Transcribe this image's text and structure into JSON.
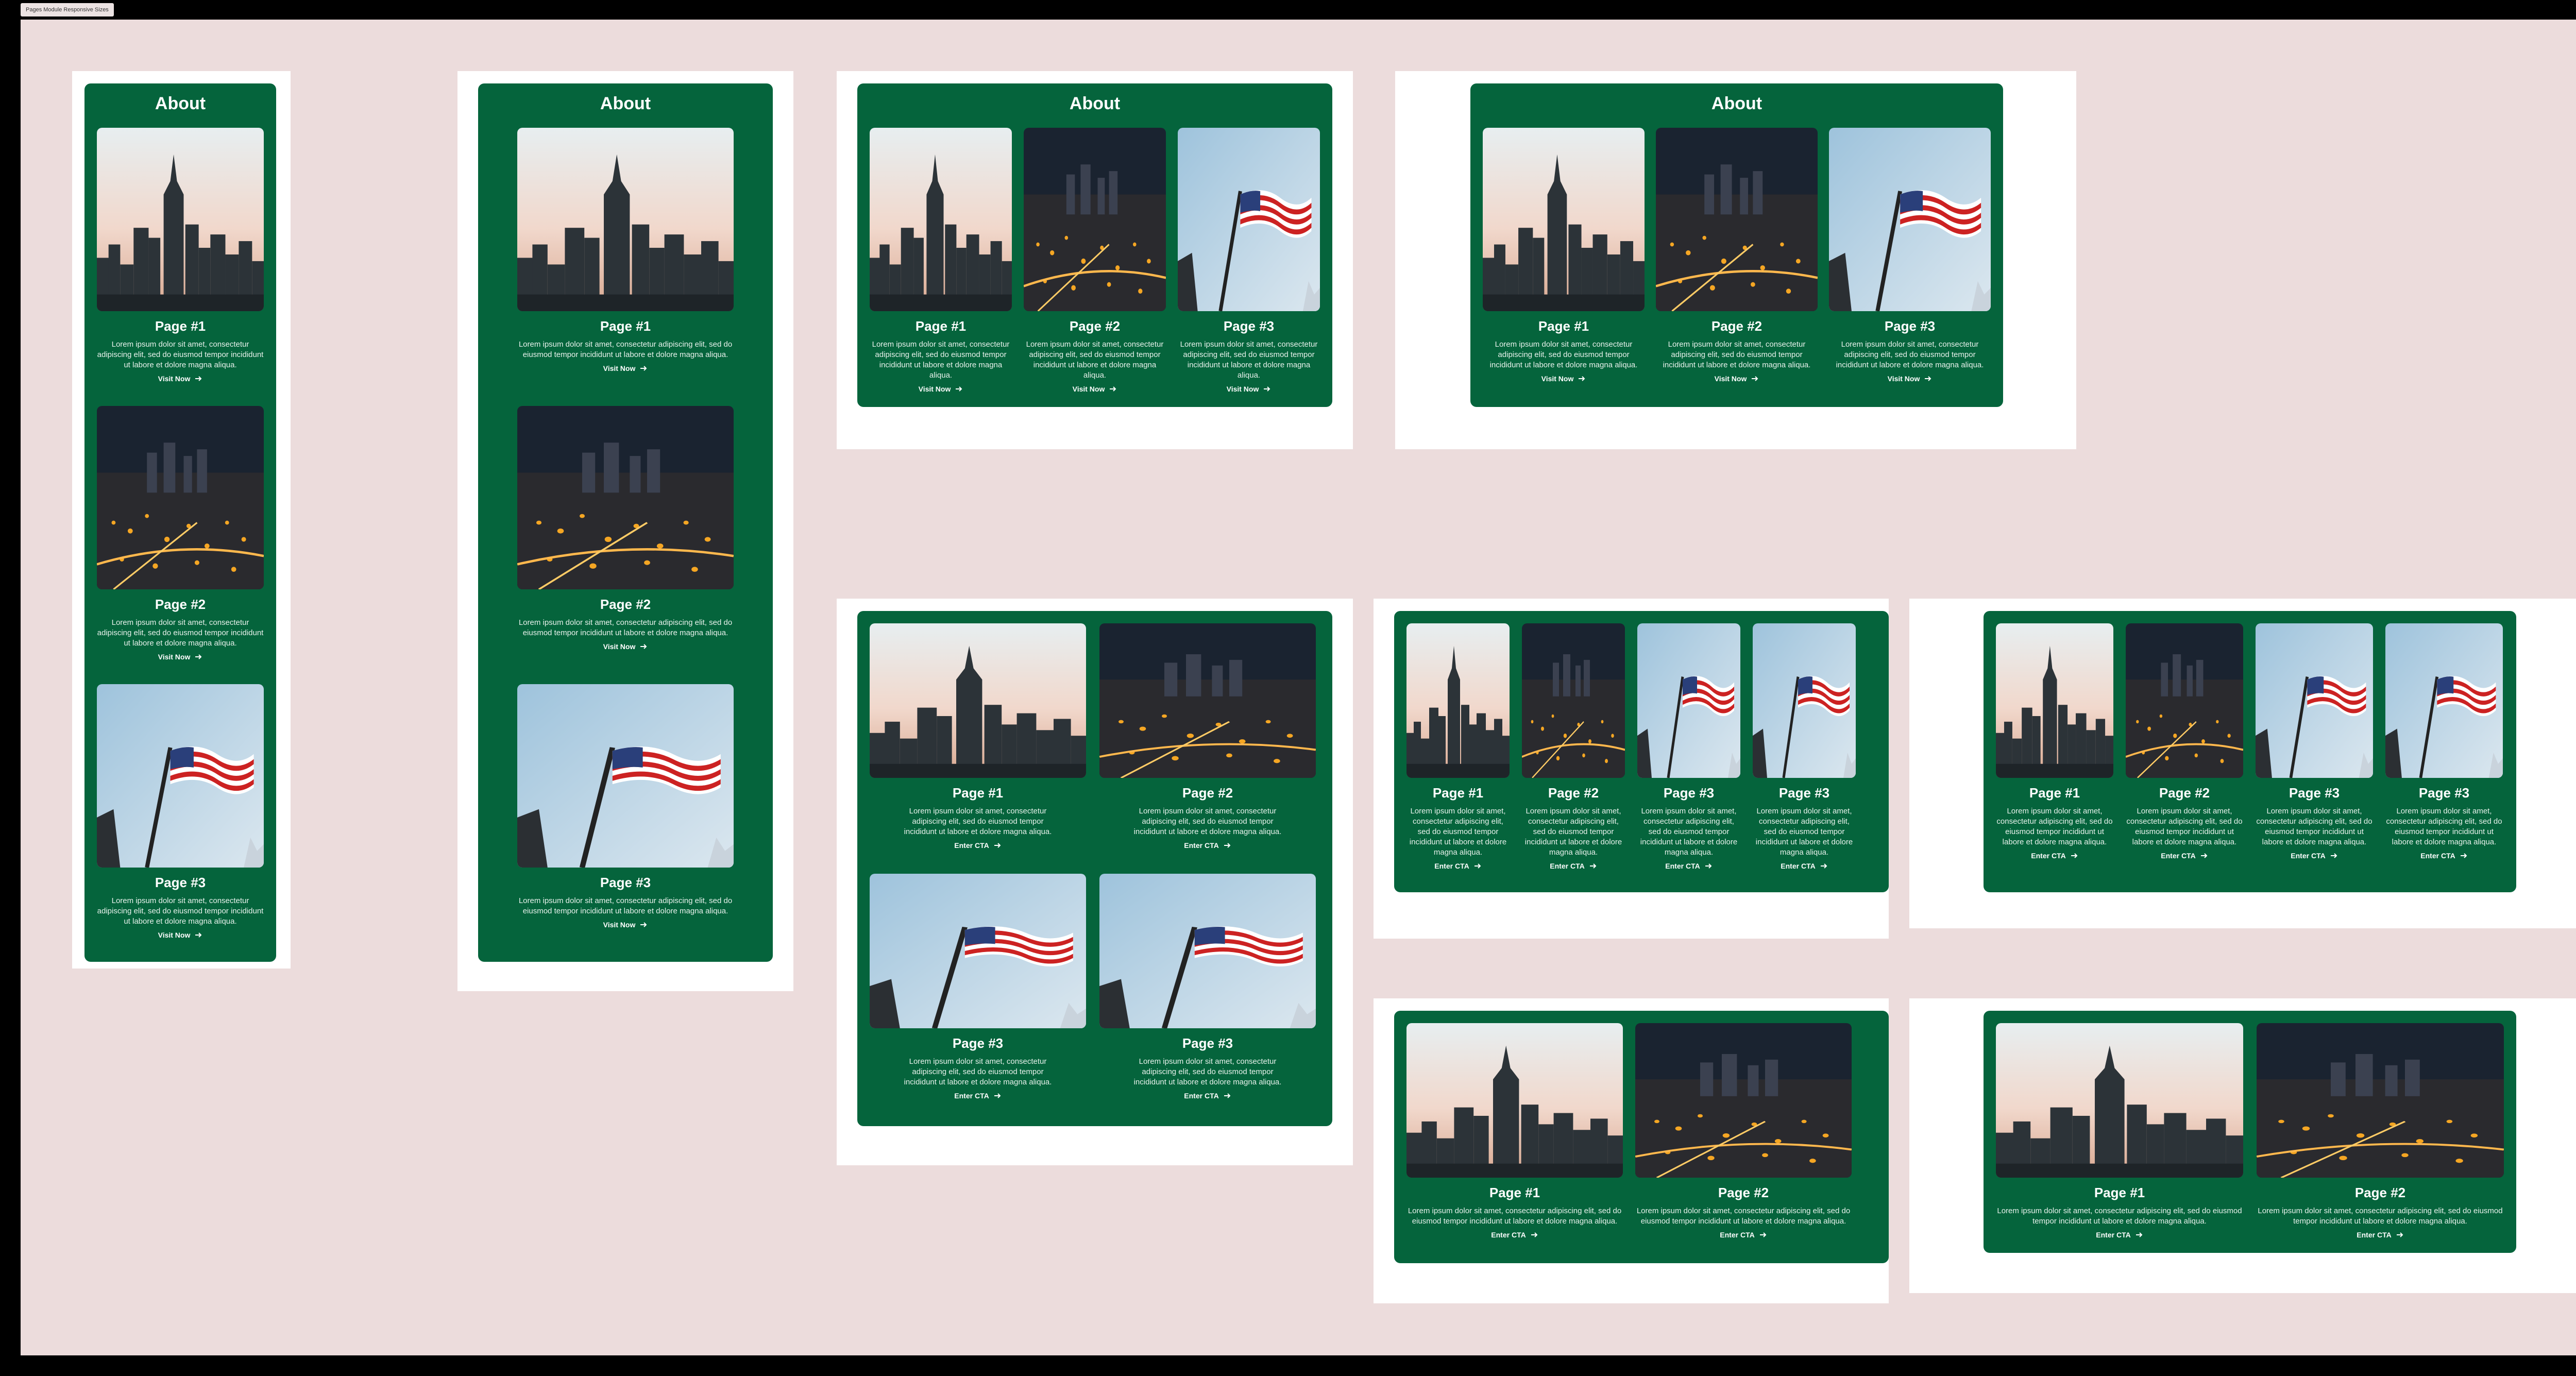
{
  "window": {
    "tab_label": "Pages Module Responsive Sizes"
  },
  "module_title": "About",
  "lorem": "Lorem ipsum dolor sit amet, consectetur adipiscing elit, sed do eiusmod tempor incididunt ut labore et dolore magna aliqua.",
  "cta": {
    "visit": "Visit Now",
    "enter": "Enter CTA"
  },
  "pages": {
    "p1": "Page #1",
    "p2": "Page #2",
    "p3": "Page #3"
  },
  "colors": {
    "canvas": "#ecdcdc",
    "module": "#05643c",
    "artboard": "#ffffff"
  },
  "icons": {
    "arrow": "arrow-right-icon"
  },
  "images": {
    "skyline_day": "city-skyline-dusk-photo",
    "skyline_night": "city-night-aerial-photo",
    "flag": "american-flag-photo"
  }
}
